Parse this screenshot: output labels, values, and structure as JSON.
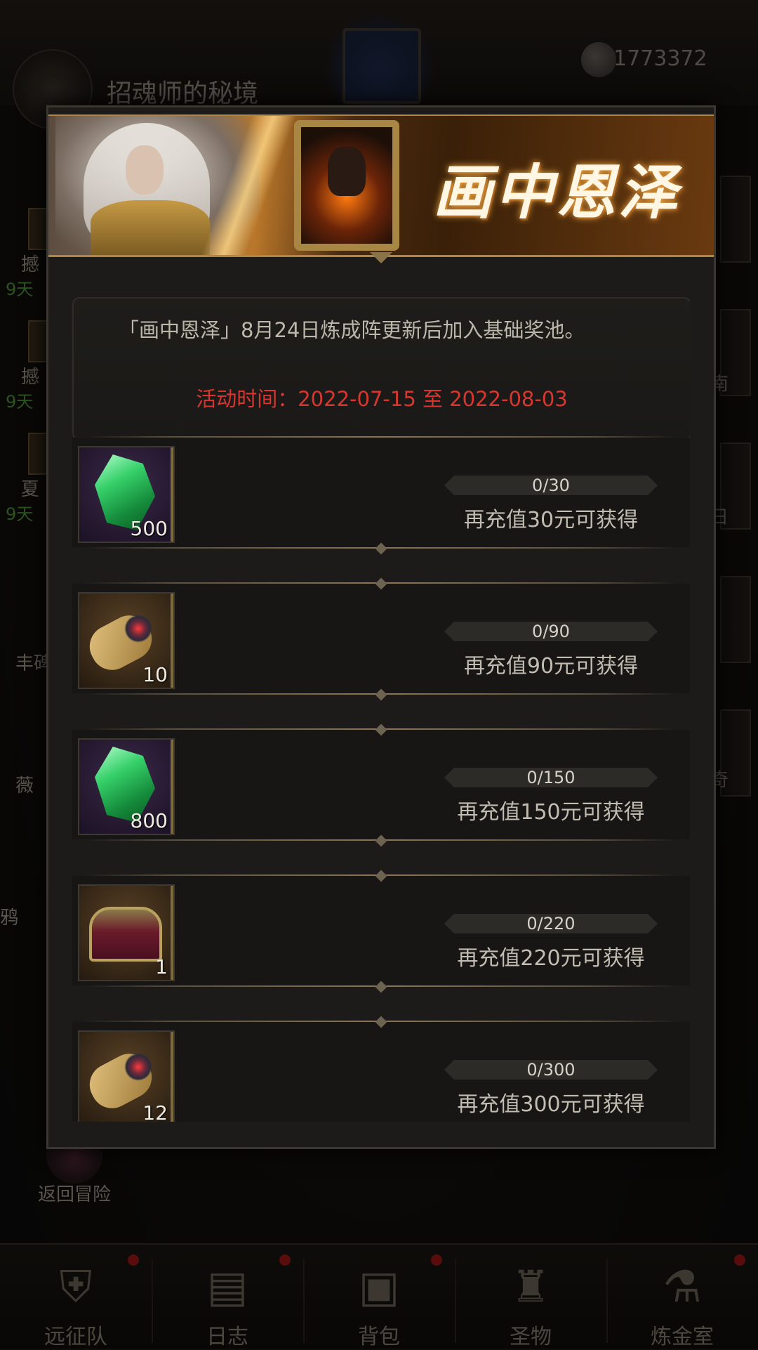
{
  "header": {
    "map_title": "招魂师的秘境",
    "currency_value": "1773372"
  },
  "left_side": [
    {
      "label": "撼",
      "days": "9天"
    },
    {
      "label": "撼",
      "days": "9天"
    },
    {
      "label": "夏",
      "days": "9天"
    },
    {
      "label": "丰碑"
    },
    {
      "label": "薇"
    },
    {
      "label": "鸦"
    }
  ],
  "right_side": [
    {
      "label": "南"
    },
    {
      "label": "日"
    },
    {
      "label": "奇"
    }
  ],
  "return_label": "返回冒险",
  "bottom_nav": [
    {
      "label": "远征队",
      "icon": "helmet-icon"
    },
    {
      "label": "日志",
      "icon": "journal-icon"
    },
    {
      "label": "背包",
      "icon": "backpack-icon"
    },
    {
      "label": "圣物",
      "icon": "relic-icon"
    },
    {
      "label": "炼金室",
      "icon": "alchemy-icon"
    }
  ],
  "dialog": {
    "banner_title": "画中恩泽",
    "description": "「画中恩泽」8月24日炼成阵更新后加入基础奖池。",
    "event_time": "活动时间：2022-07-15 至 2022-08-03",
    "rewards": [
      {
        "item": "green-gem-icon",
        "count": "500",
        "progress_text": "0/30",
        "progress": 0,
        "requirement": "再充值30元可获得",
        "slot": "purple"
      },
      {
        "item": "scroll-icon",
        "count": "10",
        "progress_text": "0/90",
        "progress": 0,
        "requirement": "再充值90元可获得",
        "slot": "orange"
      },
      {
        "item": "green-gem-icon",
        "count": "800",
        "progress_text": "0/150",
        "progress": 0,
        "requirement": "再充值150元可获得",
        "slot": "purple"
      },
      {
        "item": "treasure-chest-icon",
        "count": "1",
        "progress_text": "0/220",
        "progress": 0,
        "requirement": "再充值220元可获得",
        "slot": "orange"
      },
      {
        "item": "scroll-icon",
        "count": "12",
        "progress_text": "0/300",
        "progress": 0,
        "requirement": "再充值300元可获得",
        "slot": "orange"
      }
    ]
  },
  "colors": {
    "event_time": "#d8362e",
    "days": "#4f9a3a",
    "banner_title": "#fff6e4"
  }
}
